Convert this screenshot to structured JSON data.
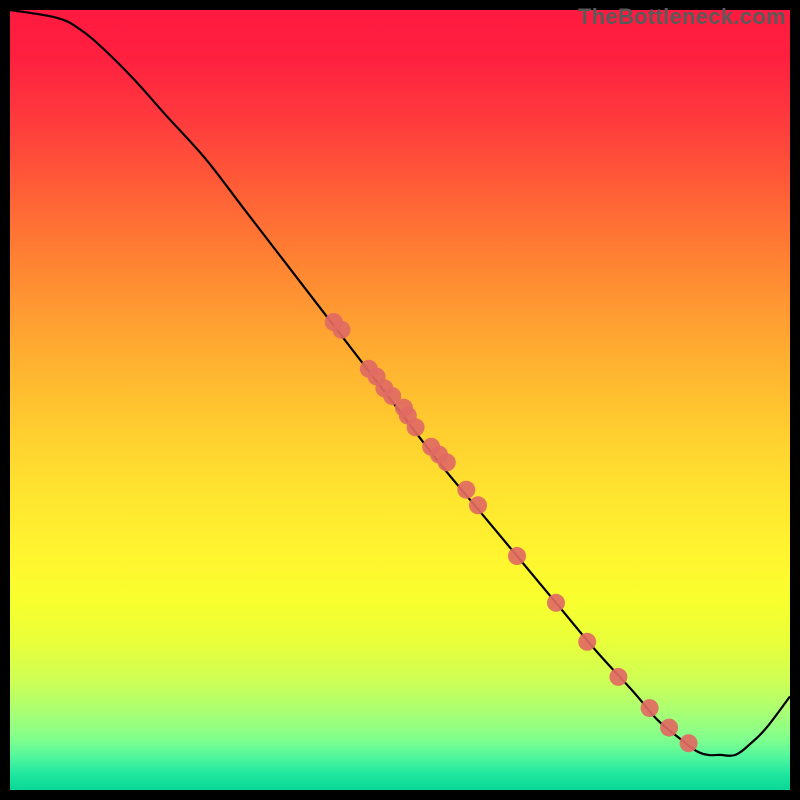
{
  "watermark": "TheBottleneck.com",
  "chart_data": {
    "type": "line",
    "title": "",
    "xlabel": "",
    "ylabel": "",
    "xlim": [
      0,
      100
    ],
    "ylim": [
      0,
      100
    ],
    "curve": {
      "x": [
        0,
        6,
        9,
        12,
        16,
        20,
        25,
        30,
        35,
        40,
        45,
        50,
        55,
        60,
        65,
        70,
        75,
        80,
        83,
        86,
        88,
        89.5,
        91,
        93,
        95,
        97,
        100
      ],
      "y": [
        100,
        99,
        97.5,
        95,
        91,
        86.5,
        81,
        74.5,
        68,
        61.5,
        55,
        48.5,
        42,
        36,
        30,
        24,
        18,
        12.5,
        9,
        6.5,
        5,
        4.5,
        4.5,
        4.5,
        6,
        8,
        12
      ]
    },
    "scatter": {
      "x": [
        41.5,
        42.5,
        46,
        47,
        48,
        49,
        50.5,
        51,
        52,
        54,
        55,
        56,
        58.5,
        60,
        65,
        70,
        74,
        78,
        82,
        84.5,
        87
      ],
      "y": [
        60,
        59,
        54,
        53,
        51.5,
        50.5,
        49,
        48,
        46.5,
        44,
        43,
        42,
        38.5,
        36.5,
        30,
        24,
        19,
        14.5,
        10.5,
        8,
        6
      ]
    },
    "gradient_stops": [
      {
        "pos": 0.0,
        "color": "#ff1a3f"
      },
      {
        "pos": 0.06,
        "color": "#ff2040"
      },
      {
        "pos": 0.14,
        "color": "#ff3a3d"
      },
      {
        "pos": 0.22,
        "color": "#ff5a38"
      },
      {
        "pos": 0.3,
        "color": "#ff7a33"
      },
      {
        "pos": 0.38,
        "color": "#ff9832"
      },
      {
        "pos": 0.46,
        "color": "#ffb430"
      },
      {
        "pos": 0.54,
        "color": "#ffce2f"
      },
      {
        "pos": 0.62,
        "color": "#ffe42f"
      },
      {
        "pos": 0.7,
        "color": "#fff52f"
      },
      {
        "pos": 0.76,
        "color": "#f8ff2e"
      },
      {
        "pos": 0.81,
        "color": "#e8ff3a"
      },
      {
        "pos": 0.86,
        "color": "#ceff55"
      },
      {
        "pos": 0.9,
        "color": "#a9ff73"
      },
      {
        "pos": 0.935,
        "color": "#80ff8d"
      },
      {
        "pos": 0.96,
        "color": "#4bf59e"
      },
      {
        "pos": 0.98,
        "color": "#1fe6a0"
      },
      {
        "pos": 1.0,
        "color": "#0ad896"
      }
    ],
    "marker_color": "#e16a63",
    "line_color": "#000000"
  }
}
